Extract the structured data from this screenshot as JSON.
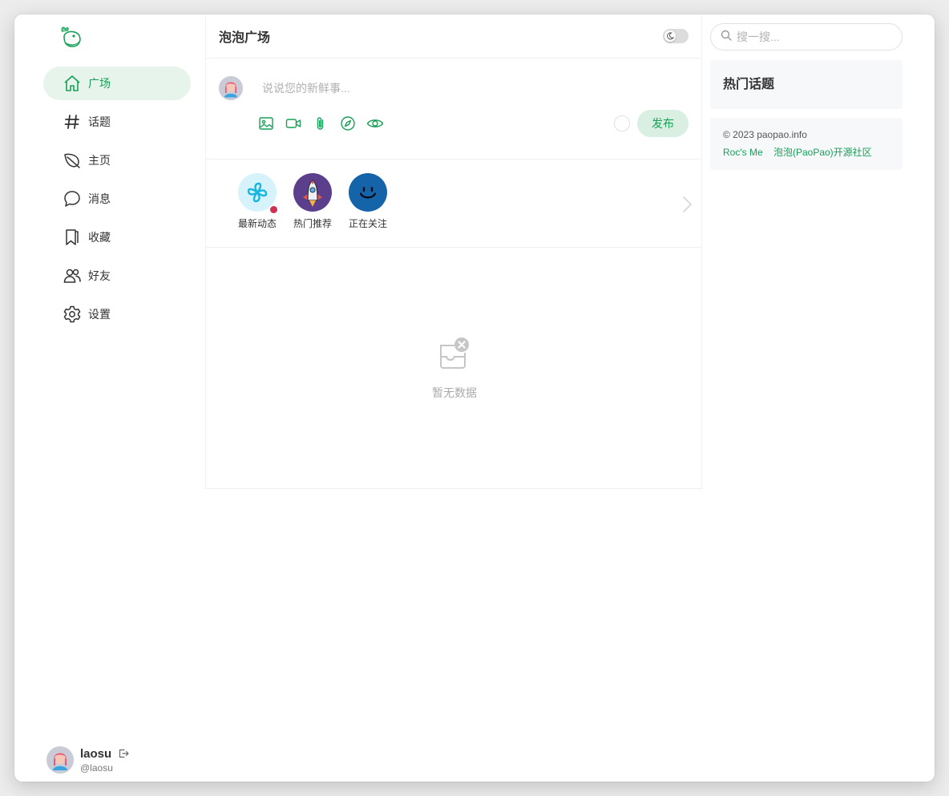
{
  "sidebar": {
    "logo_icon": "paopao-bird-logo",
    "items": [
      {
        "label": "广场",
        "icon": "home-icon",
        "active": true
      },
      {
        "label": "话题",
        "icon": "hashtag-icon",
        "active": false
      },
      {
        "label": "主页",
        "icon": "leaf-icon",
        "active": false
      },
      {
        "label": "消息",
        "icon": "chat-bubble-icon",
        "active": false
      },
      {
        "label": "收藏",
        "icon": "bookmark-icon",
        "active": false
      },
      {
        "label": "好友",
        "icon": "people-icon",
        "active": false
      },
      {
        "label": "设置",
        "icon": "gear-icon",
        "active": false
      }
    ],
    "user": {
      "name": "laosu",
      "handle": "@laosu"
    }
  },
  "main": {
    "title": "泡泡广场",
    "composer": {
      "placeholder": "说说您的新鲜事...",
      "tools": [
        "image-icon",
        "video-icon",
        "attachment-icon",
        "compass-icon",
        "eye-icon"
      ],
      "publish_label": "发布"
    },
    "channels": [
      {
        "label": "最新动态",
        "icon": "pinwheel-icon",
        "has_dot": true
      },
      {
        "label": "热门推荐",
        "icon": "rocket-icon",
        "has_dot": false
      },
      {
        "label": "正在关注",
        "icon": "smiley-icon",
        "has_dot": false
      }
    ],
    "empty_text": "暂无数据"
  },
  "right": {
    "search_placeholder": "搜一搜...",
    "hot_title": "热门话题",
    "copyright": "© 2023 paopao.info",
    "links": [
      "Roc's Me",
      "泡泡(PaoPao)开源社区"
    ]
  },
  "colors": {
    "accent": "#18a058",
    "accent_soft": "#e7f4ec",
    "notice_dot": "#d03050",
    "card_bg": "#f7f8fa"
  }
}
